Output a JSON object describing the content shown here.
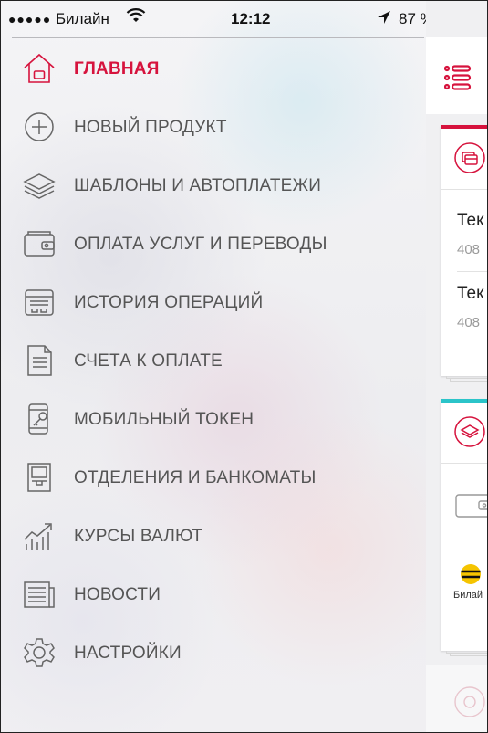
{
  "status_bar": {
    "signal": "●●●●●",
    "carrier": "Билайн",
    "time": "12:12",
    "battery_percent": "87 %"
  },
  "menu": {
    "items": [
      {
        "label": "ГЛАВНАЯ",
        "icon": "home-icon",
        "active": true
      },
      {
        "label": "НОВЫЙ ПРОДУКТ",
        "icon": "plus-circle-icon"
      },
      {
        "label": "ШАБЛОНЫ И АВТОПЛАТЕЖИ",
        "icon": "layers-icon"
      },
      {
        "label": "ОПЛАТА УСЛУГ И ПЕРЕВОДЫ",
        "icon": "wallet-icon"
      },
      {
        "label": "ИСТОРИЯ ОПЕРАЦИЙ",
        "icon": "receipt-icon"
      },
      {
        "label": "СЧЕТА К ОПЛАТЕ",
        "icon": "document-icon"
      },
      {
        "label": "МОБИЛЬНЫЙ ТОКЕН",
        "icon": "phone-key-icon"
      },
      {
        "label": "ОТДЕЛЕНИЯ И БАНКОМАТЫ",
        "icon": "atm-icon"
      },
      {
        "label": "КУРСЫ ВАЛЮТ",
        "icon": "chart-growth-icon"
      },
      {
        "label": "НОВОСТИ",
        "icon": "newspaper-icon"
      },
      {
        "label": "НАСТРОЙКИ",
        "icon": "gear-icon"
      }
    ]
  },
  "content": {
    "accounts": [
      {
        "name": "Тек",
        "number": "408"
      },
      {
        "name": "Тек",
        "number": "408"
      }
    ],
    "beeline_label": "Билай"
  },
  "colors": {
    "accent": "#d6133d",
    "teal": "#2bc4c9",
    "menu_text": "#555555"
  }
}
